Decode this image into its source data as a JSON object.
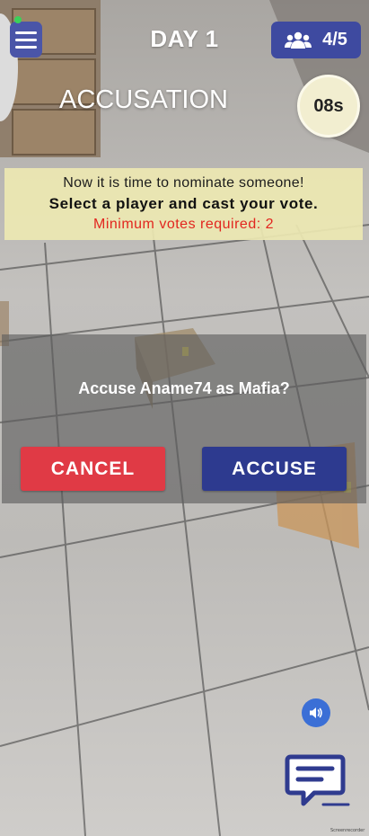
{
  "header": {
    "day_title": "DAY 1",
    "players_count": "4/5",
    "phase": "ACCUSATION",
    "timer": "08s"
  },
  "banner": {
    "line1": "Now it is time to nominate someone!",
    "line2": "Select a player and cast your vote.",
    "line3": "Minimum votes required: 2"
  },
  "dialog": {
    "question": "Accuse Aname74 as Mafia?",
    "cancel_label": "CANCEL",
    "accuse_label": "ACCUSE"
  },
  "icons": {
    "menu": "hamburger-menu-icon",
    "players": "group-icon",
    "sound": "speaker-icon",
    "chat": "chat-bubble-icon"
  },
  "watermark": "Screenrecorder",
  "colors": {
    "primary": "#3e4aa0",
    "cancel": "#e03a45",
    "accuse": "#2d3a8f",
    "banner": "#ede8b2",
    "warning_text": "#e2261f",
    "online": "#3ad15a"
  }
}
